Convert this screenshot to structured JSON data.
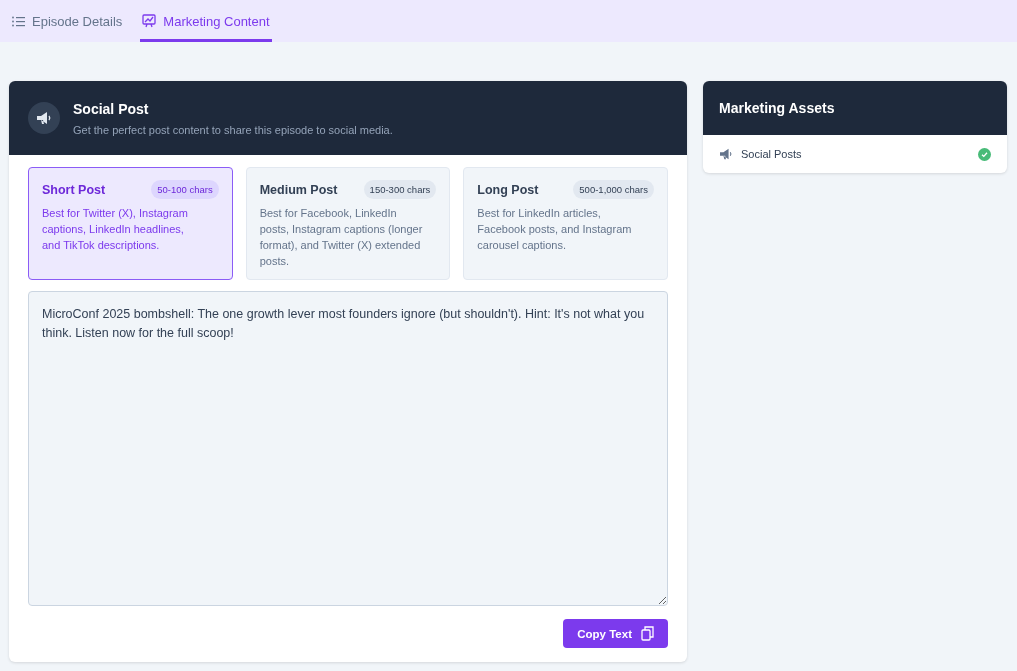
{
  "tabs": [
    {
      "label": "Episode Details",
      "selected": false
    },
    {
      "label": "Marketing Content",
      "selected": true
    }
  ],
  "social_post": {
    "title": "Social Post",
    "subtitle": "Get the perfect post content to share this episode to social media.",
    "options": [
      {
        "title": "Short Post",
        "badge": "50-100 chars",
        "description": "Best for Twitter (X), Instagram captions, LinkedIn headlines, and TikTok descriptions.",
        "selected": true
      },
      {
        "title": "Medium Post",
        "badge": "150-300 chars",
        "description": "Best for Facebook, LinkedIn posts, Instagram captions (longer format), and Twitter (X) extended posts.",
        "selected": false
      },
      {
        "title": "Long Post",
        "badge": "500-1,000 chars",
        "description": "Best for LinkedIn articles, Facebook posts, and Instagram carousel captions.",
        "selected": false
      }
    ],
    "text": "MicroConf 2025 bombshell: The one growth lever most founders ignore (but shouldn't). Hint: It's not what you think. Listen now for the full scoop!",
    "copy_button": "Copy Text"
  },
  "assets": {
    "title": "Marketing Assets",
    "items": [
      {
        "label": "Social Posts",
        "done": true
      }
    ]
  }
}
